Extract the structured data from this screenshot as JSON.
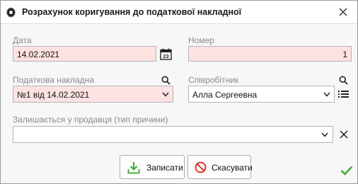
{
  "window": {
    "title": "Розрахунок коригування до податкової накладної"
  },
  "date": {
    "label": "Дата",
    "value": "14.02.2021"
  },
  "number": {
    "label": "Номер",
    "value": "1"
  },
  "tax_invoice": {
    "label": "Податкова накладна",
    "value": "№1 від 14.02.2021"
  },
  "employee": {
    "label": "Співробітник",
    "value": "Алла Сергеевна"
  },
  "seller_reason": {
    "label": "Залишається у продавця (тип причини)",
    "value": ""
  },
  "actions": {
    "save_label": "Записати",
    "cancel_label": "Скасувати"
  },
  "colors": {
    "required_bg": "#fde2e2",
    "ok_check": "#3aaa35",
    "cancel_red": "#e0241c"
  }
}
